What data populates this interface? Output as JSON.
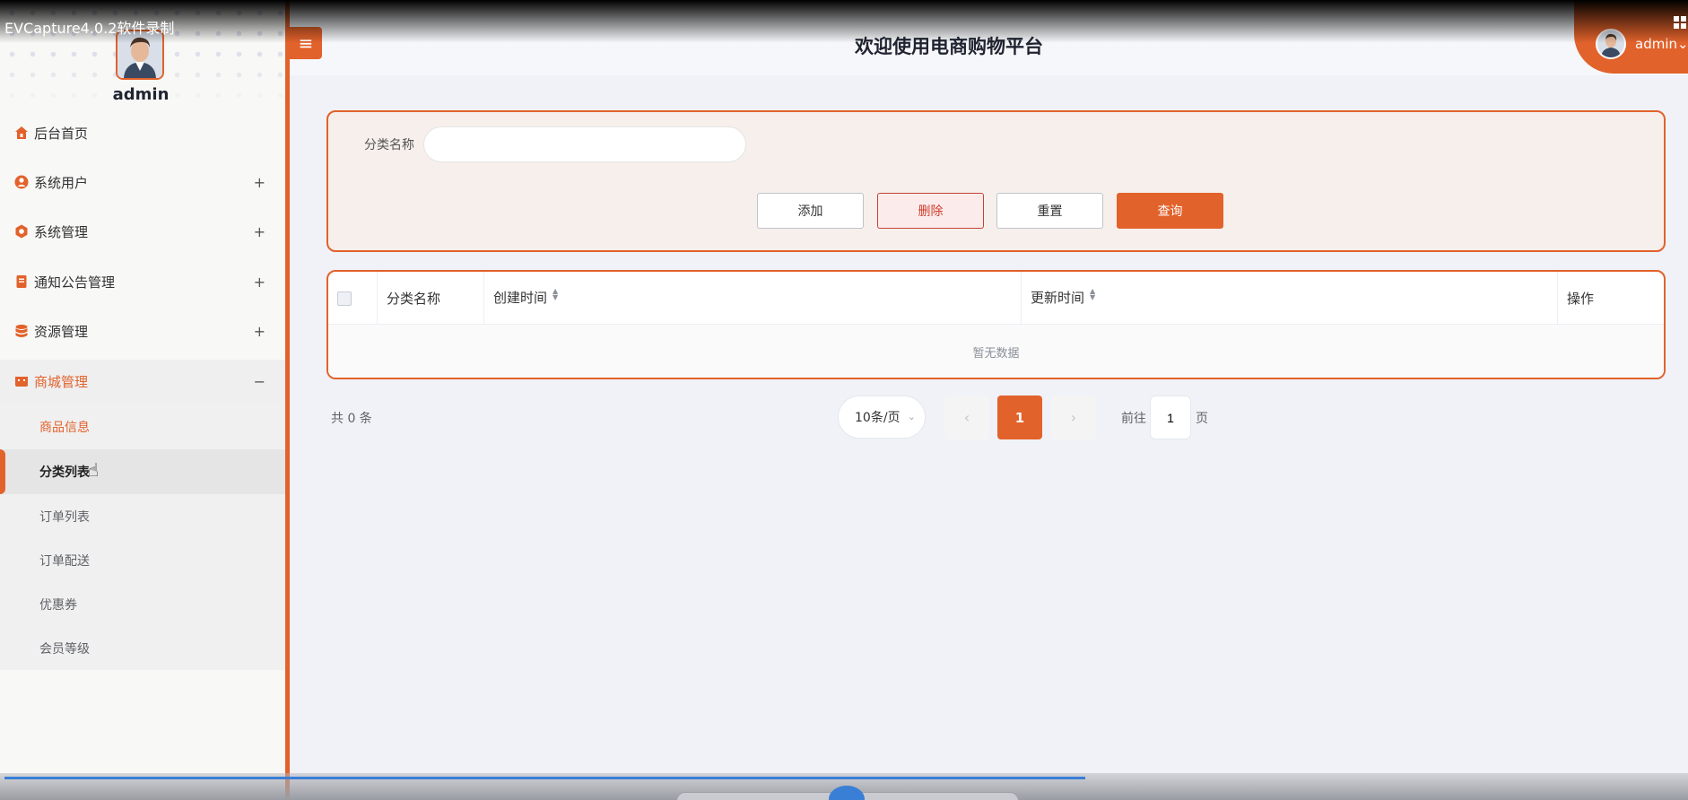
{
  "recorder": {
    "title": "EVCapture4.0.2软件录制"
  },
  "sidebar": {
    "username": "admin",
    "menu": [
      {
        "label": "后台首页",
        "icon": "home-icon",
        "expand": ""
      },
      {
        "label": "系统用户",
        "icon": "user-icon",
        "expand": "+"
      },
      {
        "label": "系统管理",
        "icon": "gear-icon",
        "expand": "+"
      },
      {
        "label": "通知公告管理",
        "icon": "document-icon",
        "expand": "+"
      },
      {
        "label": "资源管理",
        "icon": "database-icon",
        "expand": "+"
      },
      {
        "label": "商城管理",
        "icon": "shop-icon",
        "expand": "−"
      }
    ],
    "submenu": [
      {
        "label": "商品信息"
      },
      {
        "label": "分类列表"
      },
      {
        "label": "订单列表"
      },
      {
        "label": "订单配送"
      },
      {
        "label": "优惠券"
      },
      {
        "label": "会员等级"
      }
    ]
  },
  "header": {
    "title": "欢迎使用电商购物平台",
    "user": "admin",
    "user_caret": "⌄"
  },
  "search": {
    "field_label": "分类名称",
    "field_value": "",
    "buttons": {
      "add": "添加",
      "delete": "删除",
      "reset": "重置",
      "query": "查询"
    }
  },
  "table": {
    "columns": [
      "分类名称",
      "创建时间",
      "更新时间",
      "操作"
    ],
    "empty_text": "暂无数据"
  },
  "pagination": {
    "total_text": "共 0 条",
    "page_size": "10条/页",
    "current_page": "1",
    "goto_label": "前往",
    "goto_value": "1",
    "goto_suffix": "页"
  },
  "colors": {
    "accent": "#e2622b",
    "danger": "#d03b2a"
  }
}
